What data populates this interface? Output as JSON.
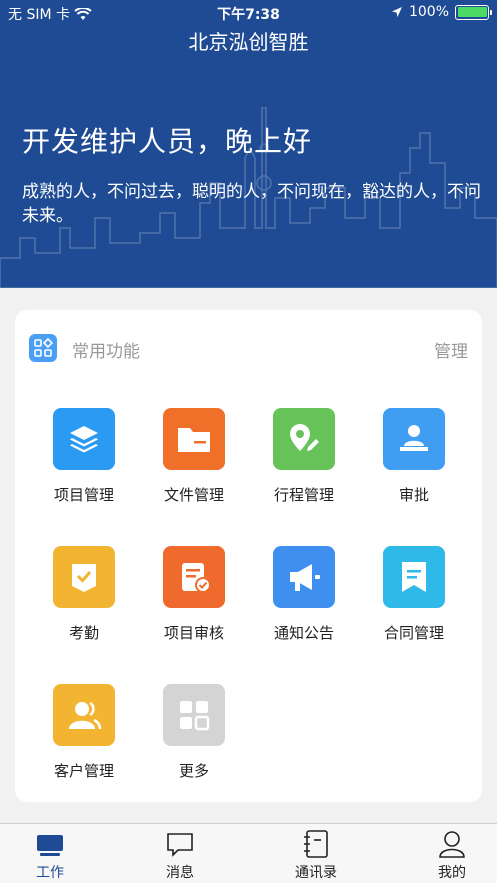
{
  "status_bar": {
    "carrier": "无 SIM 卡",
    "time": "下午7:38",
    "battery": "100%"
  },
  "header": {
    "title": "北京泓创智胜",
    "greeting": "开发维护人员，晚上好",
    "motto": "成熟的人，不问过去，聪明的人，不问现在，豁达的人，不问未来。"
  },
  "functions": {
    "title": "常用功能",
    "manage_label": "管理",
    "items": [
      {
        "label": "项目管理",
        "icon": "layers-icon",
        "color": "#2b9af3"
      },
      {
        "label": "文件管理",
        "icon": "folder-icon",
        "color": "#f0702a"
      },
      {
        "label": "行程管理",
        "icon": "map-pin-icon",
        "color": "#67c25a"
      },
      {
        "label": "审批",
        "icon": "approval-person-icon",
        "color": "#3f9ef2"
      },
      {
        "label": "考勤",
        "icon": "attendance-check-icon",
        "color": "#f3b431"
      },
      {
        "label": "项目审核",
        "icon": "document-check-icon",
        "color": "#ef6a2c"
      },
      {
        "label": "通知公告",
        "icon": "megaphone-icon",
        "color": "#3f8ff0"
      },
      {
        "label": "合同管理",
        "icon": "contract-icon",
        "color": "#2eb9e8"
      },
      {
        "label": "客户管理",
        "icon": "customer-icon",
        "color": "#f3b431"
      },
      {
        "label": "更多",
        "icon": "more-grid-icon",
        "color": "#d4d4d4"
      }
    ]
  },
  "tabbar": {
    "items": [
      {
        "label": "工作",
        "icon": "work-monitor-icon",
        "active": true
      },
      {
        "label": "消息",
        "icon": "message-bubble-icon",
        "active": false
      },
      {
        "label": "通讯录",
        "icon": "contacts-book-icon",
        "active": false
      },
      {
        "label": "我的",
        "icon": "profile-person-icon",
        "active": false
      }
    ],
    "active_color": "#1e4b93"
  }
}
